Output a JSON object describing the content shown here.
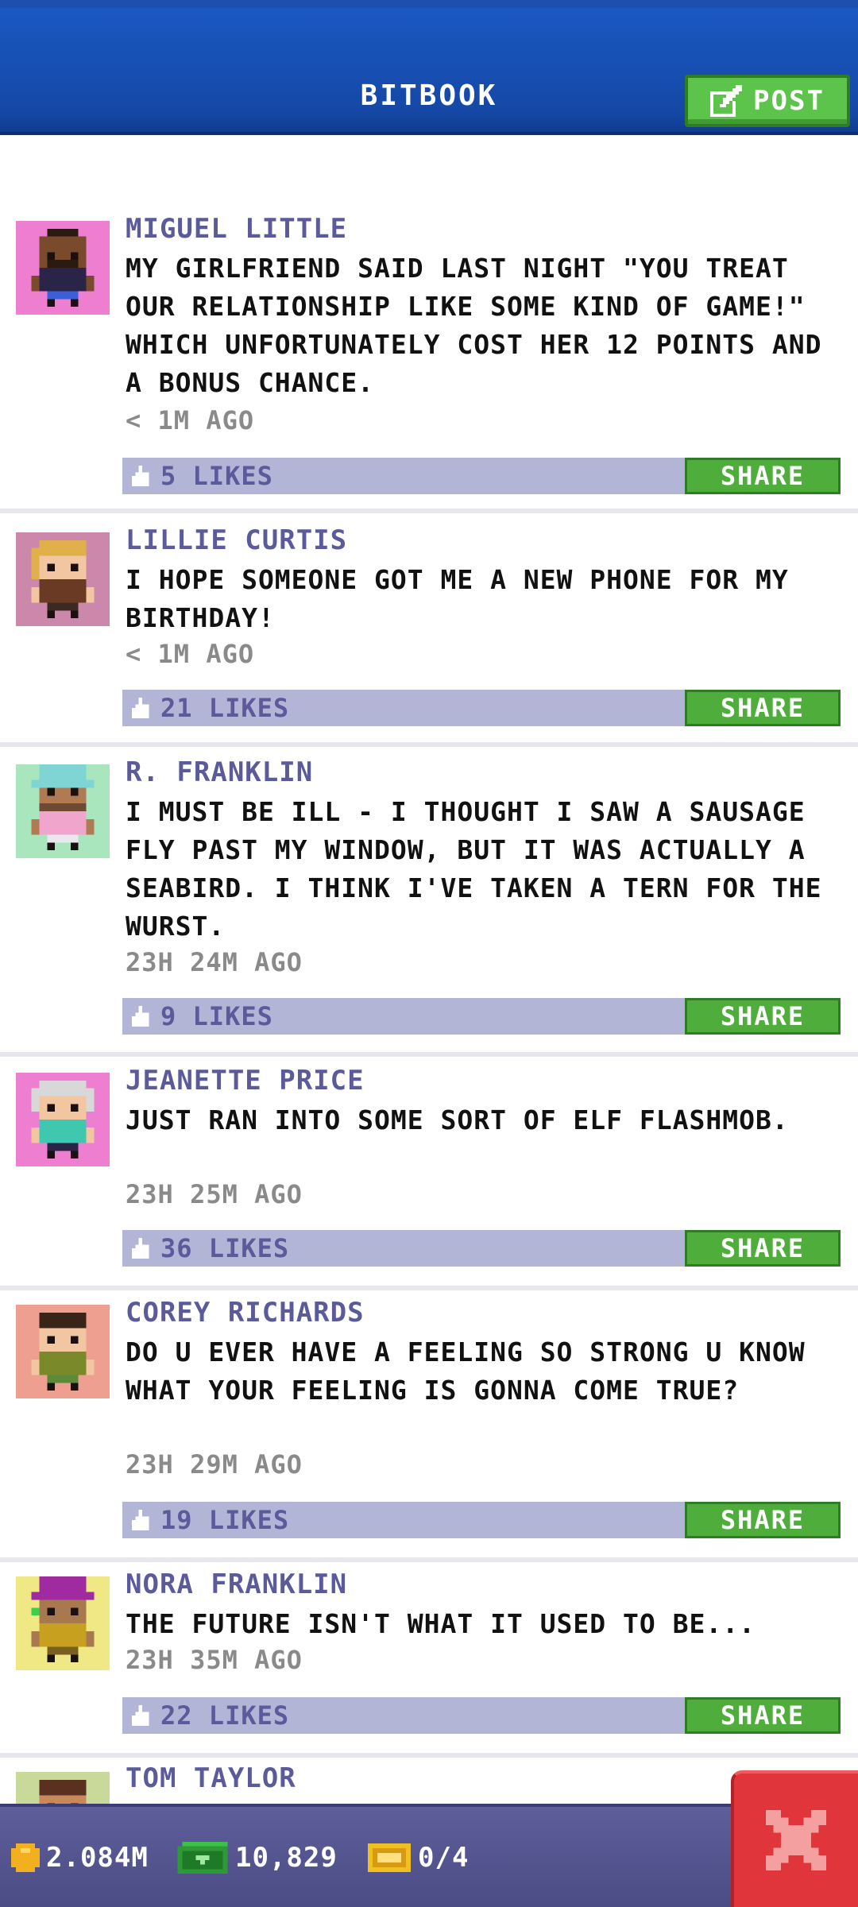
{
  "header": {
    "title": "BITBOOK",
    "post_label": "POST"
  },
  "posts": [
    {
      "name": "MIGUEL LITTLE",
      "text": "MY GIRLFRIEND SAID LAST NIGHT \"YOU TREAT OUR RELATIONSHIP LIKE SOME KIND OF GAME!\" WHICH UNFORTUNATELY COST HER 12 POINTS AND A BONUS CHANCE.",
      "time": "< 1M AGO",
      "likes": "5 LIKES",
      "share": "SHARE",
      "avatar_bg": "#ee7fd0",
      "avatar": "avatar-miguel-little"
    },
    {
      "name": "LILLIE CURTIS",
      "text": "I HOPE SOMEONE GOT ME A NEW PHONE FOR MY BIRTHDAY!",
      "time": "< 1M AGO",
      "likes": "21 LIKES",
      "share": "SHARE",
      "avatar_bg": "#cc88aa",
      "avatar": "avatar-lillie-curtis"
    },
    {
      "name": "R. FRANKLIN",
      "text": "I MUST BE ILL - I THOUGHT I SAW A SAUSAGE FLY PAST MY WINDOW, BUT IT WAS ACTUALLY A SEABIRD. I THINK I'VE TAKEN A TERN FOR THE WURST.",
      "time": "23H 24M AGO",
      "likes": "9 LIKES",
      "share": "SHARE",
      "avatar_bg": "#a9e6bd",
      "avatar": "avatar-r-franklin"
    },
    {
      "name": "JEANETTE PRICE",
      "text": "JUST RAN INTO SOME SORT OF ELF FLASHMOB.",
      "time": "23H 25M AGO",
      "likes": "36 LIKES",
      "share": "SHARE",
      "avatar_bg": "#ee7fd0",
      "avatar": "avatar-jeanette-price"
    },
    {
      "name": "COREY RICHARDS",
      "text": "DO U EVER HAVE A FEELING SO STRONG U KNOW WHAT YOUR FEELING IS GONNA COME TRUE?",
      "time": "23H 29M AGO",
      "likes": "19 LIKES",
      "share": "SHARE",
      "avatar_bg": "#ee9f90",
      "avatar": "avatar-corey-richards"
    },
    {
      "name": "NORA FRANKLIN",
      "text": "THE FUTURE ISN'T WHAT IT USED TO BE...",
      "time": "23H 35M AGO",
      "likes": "22 LIKES",
      "share": "SHARE",
      "avatar_bg": "#f0e884",
      "avatar": "avatar-nora-franklin"
    },
    {
      "name": "TOM TAYLOR",
      "text": "",
      "time": "",
      "likes": "",
      "share": "",
      "avatar_bg": "#c9d99a",
      "avatar": "avatar-tom-taylor"
    }
  ],
  "footer": {
    "coins": "2.084M",
    "bux": "10,829",
    "tickets": "0/4"
  },
  "colors": {
    "header_blue": "#1a58c2",
    "post_green": "#5cc44a",
    "name_purple": "#5b5a9a",
    "like_bar": "#b3b5d6",
    "footer_purple": "#5e5f9a",
    "close_red": "#e0353a"
  }
}
